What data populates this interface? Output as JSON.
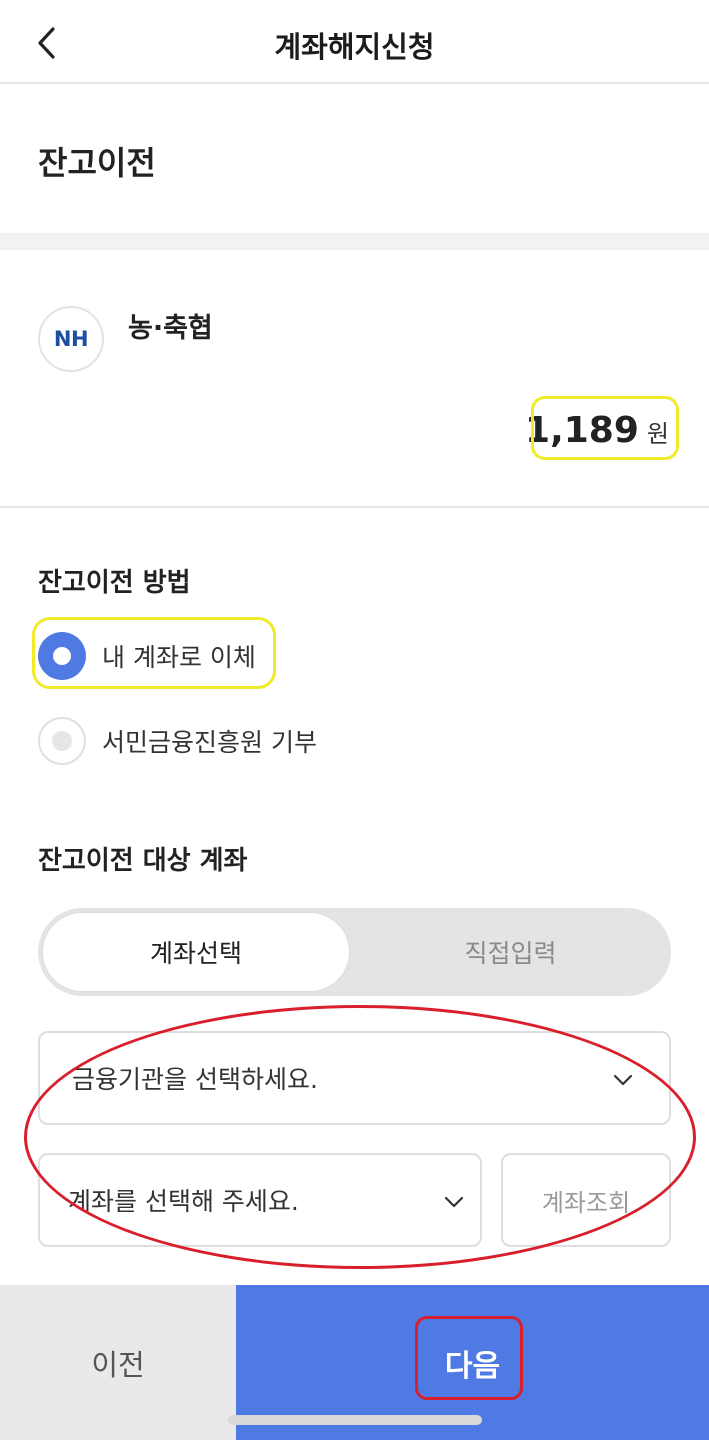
{
  "header": {
    "title": "계좌해지신청",
    "back_icon": "chevron-left-icon"
  },
  "section": {
    "title": "잔고이전"
  },
  "bank": {
    "logo_text": "NH",
    "name": "농·축협",
    "balance_value": "1,189",
    "balance_unit": "원"
  },
  "method": {
    "title": "잔고이전 방법",
    "options": [
      {
        "label": "내 계좌로 이체",
        "selected": true
      },
      {
        "label": "서민금융진흥원 기부",
        "selected": false
      }
    ]
  },
  "target": {
    "title": "잔고이전 대상 계좌",
    "tabs": [
      {
        "label": "계좌선택",
        "active": true
      },
      {
        "label": "직접입력",
        "active": false
      }
    ],
    "institution_select": "금융기관을 선택하세요.",
    "account_select": "계좌를 선택해 주세요.",
    "lookup_button": "계좌조회"
  },
  "footer": {
    "prev_label": "이전",
    "next_label": "다음"
  },
  "colors": {
    "accent": "#4f79e3",
    "highlight_yellow": "#f1ea2a",
    "highlight_red": "#d81f2b",
    "nh_blue": "#1d4ea0"
  }
}
